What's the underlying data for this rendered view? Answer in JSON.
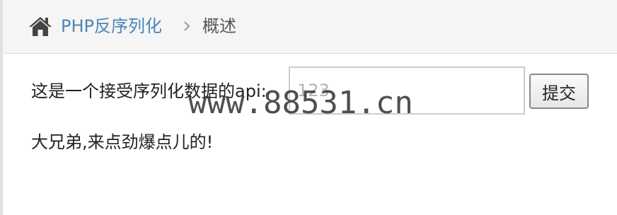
{
  "breadcrumb": {
    "icon": "home-icon",
    "link_label": "PHP反序列化",
    "separator_icon": "chevron-right-icon",
    "current_label": "概述",
    "link_color": "#4a86b8"
  },
  "form": {
    "label": "这是一个接受序列化数据的api:",
    "input_placeholder": "123",
    "input_value": "",
    "submit_label": "提交"
  },
  "message": "大兄弟,来点劲爆点儿的!",
  "watermark": "www.88531.cn"
}
